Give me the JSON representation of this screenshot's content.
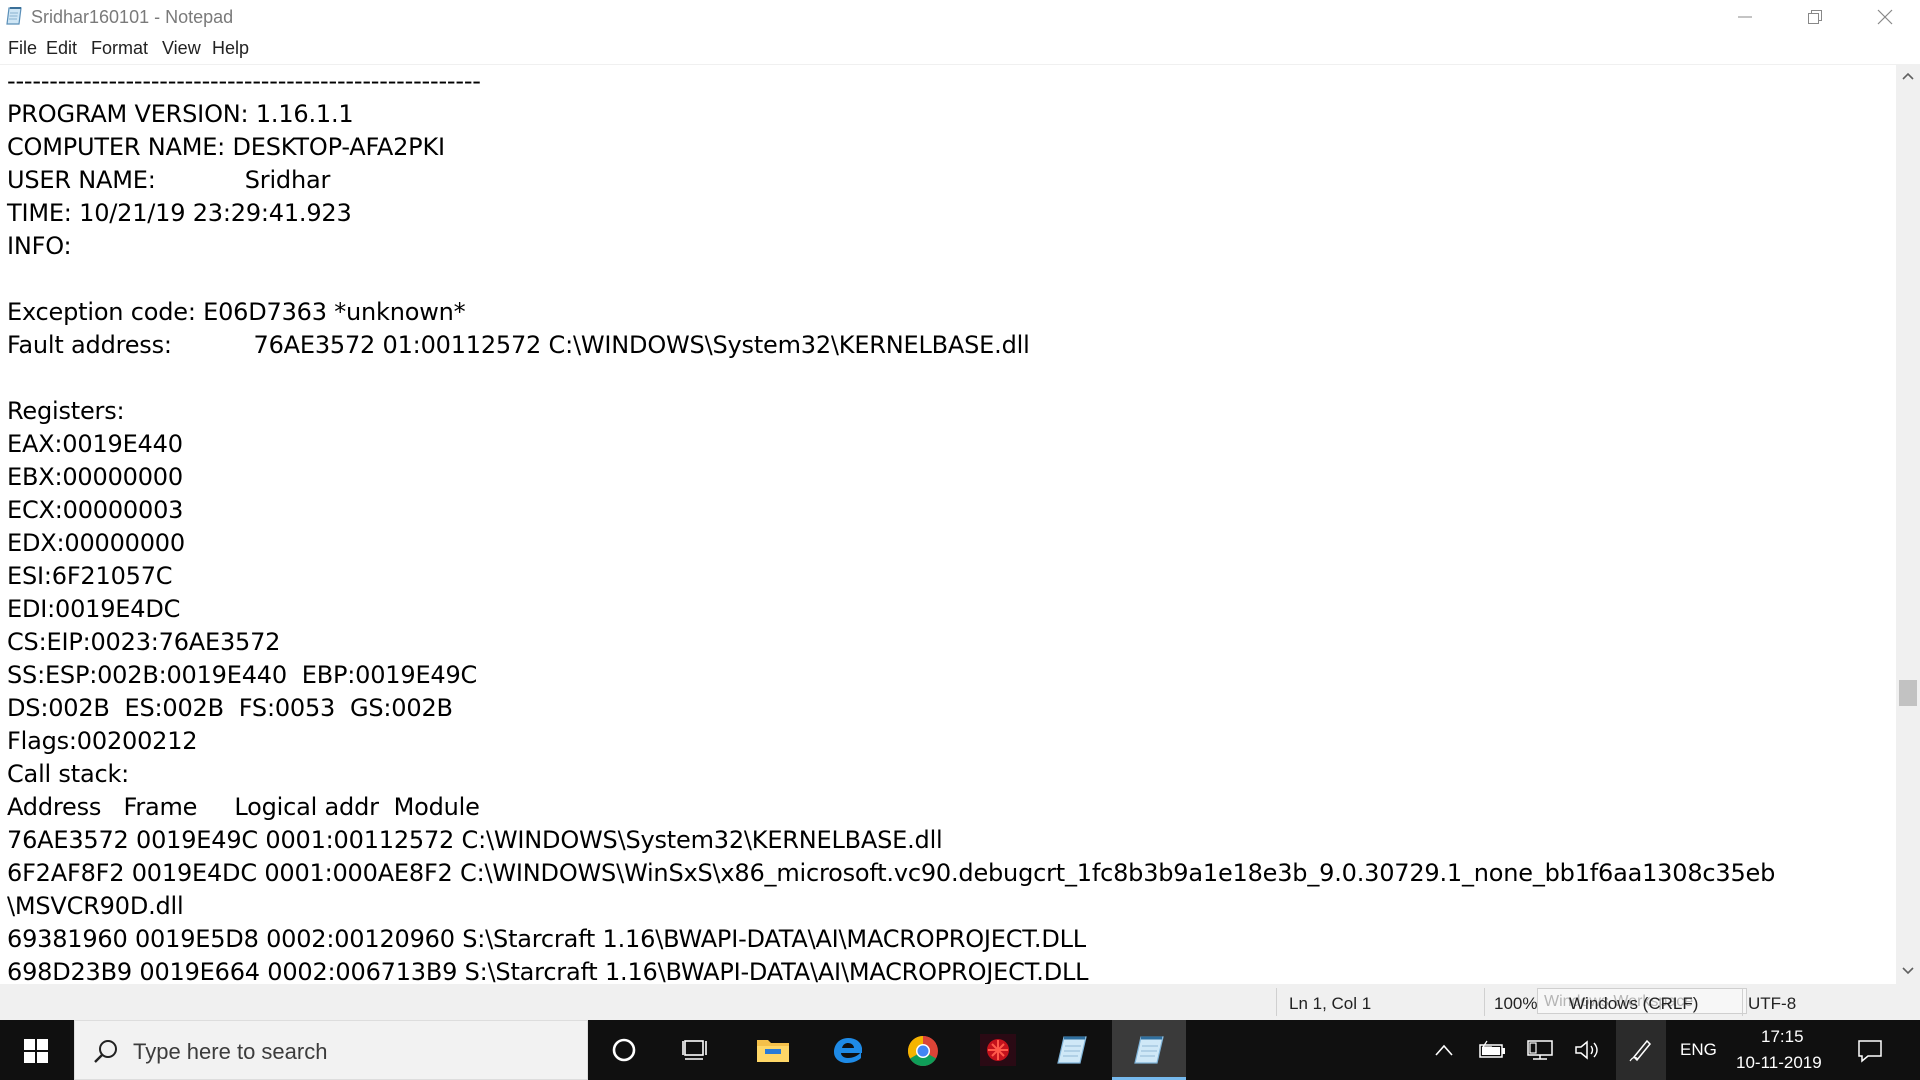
{
  "window": {
    "title": "Sridhar160101 - Notepad",
    "app_icon": "notepad-icon",
    "controls": [
      "minimize-icon",
      "restore-icon",
      "close-icon"
    ]
  },
  "menu": {
    "items": [
      "File",
      "Edit",
      "Format",
      "View",
      "Help"
    ]
  },
  "editor": {
    "lines": [
      "--------------------------------------------------------",
      "PROGRAM VERSION: 1.16.1.1",
      "COMPUTER NAME: DESKTOP-AFA2PKI",
      "USER NAME:            Sridhar",
      "TIME: 10/21/19 23:29:41.923",
      "INFO:",
      "",
      "Exception code: E06D7363 *unknown*",
      "Fault address:           76AE3572 01:00112572 C:\\WINDOWS\\System32\\KERNELBASE.dll",
      "",
      "Registers:",
      "EAX:0019E440",
      "EBX:00000000",
      "ECX:00000003",
      "EDX:00000000",
      "ESI:6F21057C",
      "EDI:0019E4DC",
      "CS:EIP:0023:76AE3572",
      "SS:ESP:002B:0019E440  EBP:0019E49C",
      "DS:002B  ES:002B  FS:0053  GS:002B",
      "Flags:00200212",
      "Call stack:",
      "Address   Frame     Logical addr  Module",
      "76AE3572 0019E49C 0001:00112572 C:\\WINDOWS\\System32\\KERNELBASE.dll",
      "6F2AF8F2 0019E4DC 0001:000AE8F2 C:\\WINDOWS\\WinSxS\\x86_microsoft.vc90.debugcrt_1fc8b3b9a1e18e3b_9.0.30729.1_none_bb1f6aa1308c35eb",
      "\\MSVCR90D.dll",
      "69381960 0019E5D8 0002:00120960 S:\\Starcraft 1.16\\BWAPI-DATA\\AI\\MACROPROJECT.DLL",
      "698D23B9 0019E664 0002:006713B9 S:\\Starcraft 1.16\\BWAPI-DATA\\AI\\MACROPROJECT.DLL"
    ]
  },
  "status": {
    "position": "Ln 1, Col 1",
    "zoom": "100%",
    "line_ending": "Windows (CRLF)",
    "tooltip": "Windows Workspace",
    "encoding": "UTF-8"
  },
  "taskbar": {
    "search_placeholder": "Type here to search",
    "apps": [
      "cortana-icon",
      "task-view-icon",
      "file-explorer-icon",
      "edge-icon",
      "chrome-icon",
      "red-app-icon",
      "notepad-icon",
      "notepad-icon"
    ],
    "tray": {
      "language": "ENG",
      "time": "17:15",
      "date": "10-11-2019"
    }
  }
}
